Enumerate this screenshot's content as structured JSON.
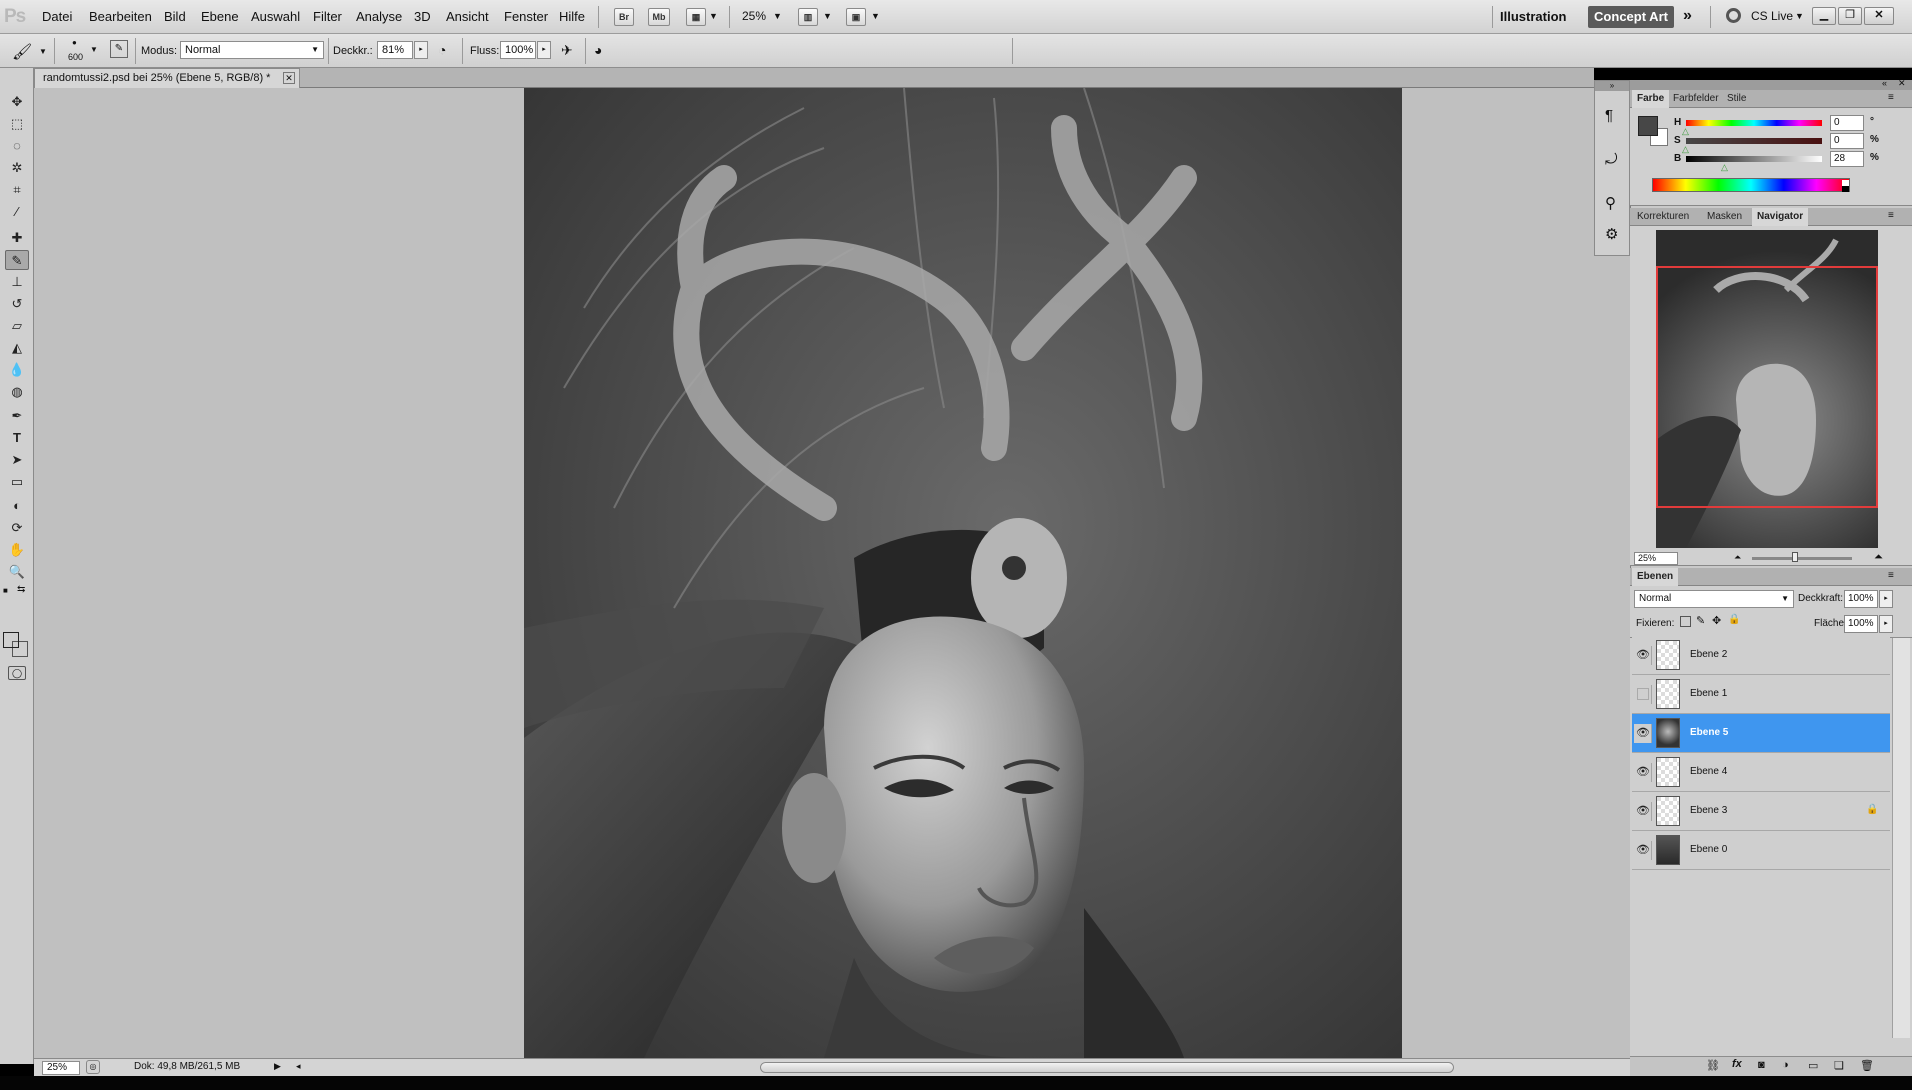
{
  "app": {
    "logo": "Ps"
  },
  "menu": [
    "Datei",
    "Bearbeiten",
    "Bild",
    "Ebene",
    "Auswahl",
    "Filter",
    "Analyse",
    "3D",
    "Ansicht",
    "Fenster",
    "Hilfe"
  ],
  "appbar": {
    "bridge": "Br",
    "minibridge": "Mb",
    "zoom": "25%"
  },
  "workspaces": {
    "illustration": "Illustration",
    "concept_art": "Concept Art",
    "cs_live": "CS Live"
  },
  "options": {
    "brush_size": "600",
    "mode_label": "Modus:",
    "mode_value": "Normal",
    "opacity_label": "Deckkr.:",
    "opacity_value": "81%",
    "flow_label": "Fluss:",
    "flow_value": "100%"
  },
  "document": {
    "tab_title": "randomtussi2.psd bei 25% (Ebene 5, RGB/8) *"
  },
  "status": {
    "zoom": "25%",
    "doc_size": "Dok: 49,8 MB/261,5 MB"
  },
  "color_panel": {
    "tabs": [
      "Farbe",
      "Farbfelder",
      "Stile"
    ],
    "h_label": "H",
    "h_value": "0",
    "h_unit": "°",
    "s_label": "S",
    "s_value": "0",
    "s_unit": "%",
    "b_label": "B",
    "b_value": "28",
    "b_unit": "%",
    "foreground": "#474747",
    "background": "#ffffff"
  },
  "nav_panel": {
    "tabs": [
      "Korrekturen",
      "Masken",
      "Navigator"
    ],
    "zoom": "25%"
  },
  "layers_panel": {
    "tab": "Ebenen",
    "blend_mode": "Normal",
    "opacity_label": "Deckkraft:",
    "opacity_value": "100%",
    "lock_label": "Fixieren:",
    "fill_label": "Fläche:",
    "fill_value": "100%",
    "layers": [
      {
        "name": "Ebene 2",
        "visible": true,
        "selected": false
      },
      {
        "name": "Ebene 1",
        "visible": false,
        "selected": false
      },
      {
        "name": "Ebene 5",
        "visible": true,
        "selected": true
      },
      {
        "name": "Ebene 4",
        "visible": true,
        "selected": false
      },
      {
        "name": "Ebene 3",
        "visible": true,
        "selected": false
      },
      {
        "name": "Ebene 0",
        "visible": true,
        "selected": false
      }
    ]
  },
  "colors": {
    "selection": "#3f96ef",
    "concept_art_bg": "#5a5a5a",
    "nav_view_box": "#e23b3b"
  }
}
